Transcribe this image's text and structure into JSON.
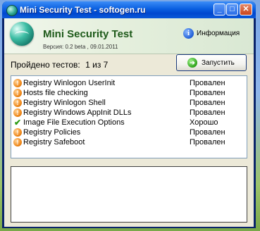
{
  "window": {
    "title": "Mini Security Test - softogen.ru"
  },
  "titlebar_buttons": {
    "minimize": "_",
    "maximize": "□",
    "close": "✕"
  },
  "header": {
    "app_name": "Mini Security Test",
    "version": "Версия: 0.2 beta , 09.01.2011",
    "info_label": "Информация",
    "info_icon": "i"
  },
  "summary": {
    "label": "Пройдено тестов:",
    "value": "1 из 7"
  },
  "run_button": {
    "label": "Запустить",
    "icon": "➔"
  },
  "status_icons": {
    "fail": "!",
    "ok": "✔"
  },
  "tests": [
    {
      "name": "Registry Winlogon UserInit",
      "result": "Провален",
      "status": "fail"
    },
    {
      "name": "Hosts file checking",
      "result": "Провален",
      "status": "fail"
    },
    {
      "name": "Registry Winlogon Shell",
      "result": "Провален",
      "status": "fail"
    },
    {
      "name": "Registry Windows AppInit DLLs",
      "result": "Провален",
      "status": "fail"
    },
    {
      "name": "Image File Execution Options",
      "result": "Хорошо",
      "status": "ok"
    },
    {
      "name": "Registry Policies",
      "result": "Провален",
      "status": "fail"
    },
    {
      "name": "Registry Safeboot",
      "result": "Провален",
      "status": "fail"
    }
  ],
  "log": {
    "text": ""
  }
}
